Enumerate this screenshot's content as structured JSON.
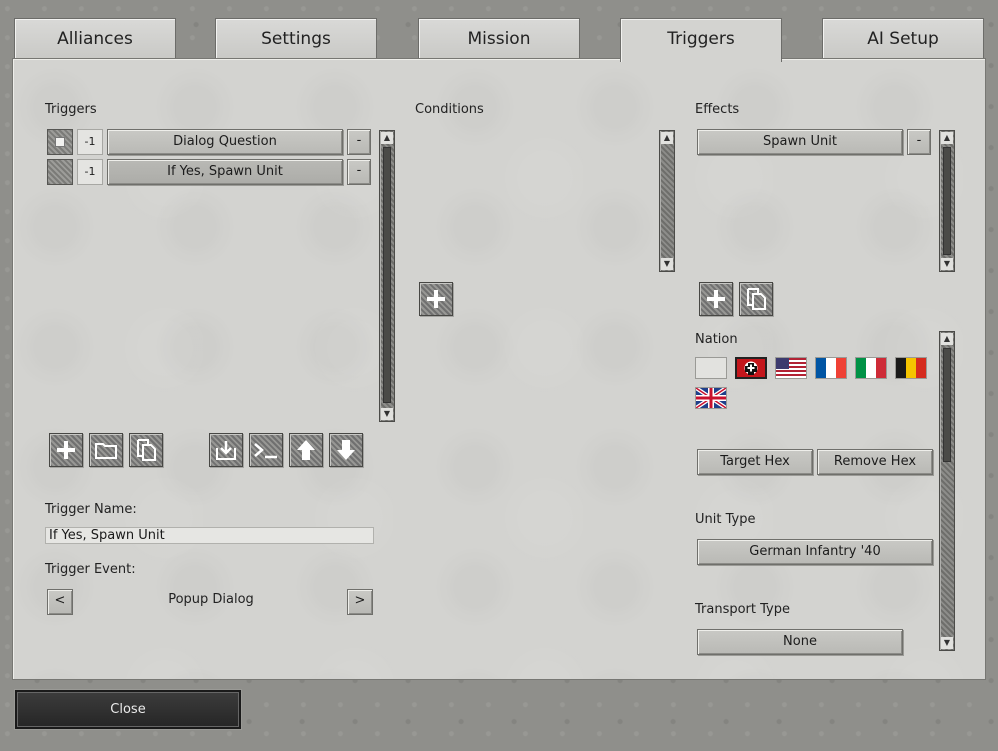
{
  "tabs": [
    {
      "label": "Alliances"
    },
    {
      "label": "Settings"
    },
    {
      "label": "Mission"
    },
    {
      "label": "Triggers",
      "active": true
    },
    {
      "label": "AI Setup"
    }
  ],
  "triggers": {
    "header": "Triggers",
    "rows": [
      {
        "number": "-1",
        "label": "Dialog Question",
        "remove": "-"
      },
      {
        "number": "-1",
        "label": "If Yes, Spawn Unit",
        "remove": "-"
      }
    ],
    "name_label": "Trigger Name:",
    "name_value": "If Yes, Spawn Unit",
    "event_label": "Trigger Event:",
    "event_value": "Popup Dialog",
    "prev": "<",
    "next": ">"
  },
  "conditions": {
    "header": "Conditions"
  },
  "effects": {
    "header": "Effects",
    "rows": [
      {
        "label": "Spawn Unit",
        "remove": "-"
      }
    ],
    "nation_label": "Nation",
    "nations": [
      "none-flag",
      "german-flag",
      "us-flag",
      "french-flag",
      "italian-flag",
      "belgian-flag",
      "british-flag"
    ],
    "target_hex": "Target Hex",
    "remove_hex": "Remove Hex",
    "unit_type_label": "Unit Type",
    "unit_type_value": "German Infantry '40",
    "transport_type_label": "Transport Type",
    "transport_type_value": "None"
  },
  "footer": {
    "close": "Close"
  },
  "colors": {
    "panel": "#d3d3d0",
    "button": "#c2c2be",
    "dark_button": "#2e2e2e"
  }
}
